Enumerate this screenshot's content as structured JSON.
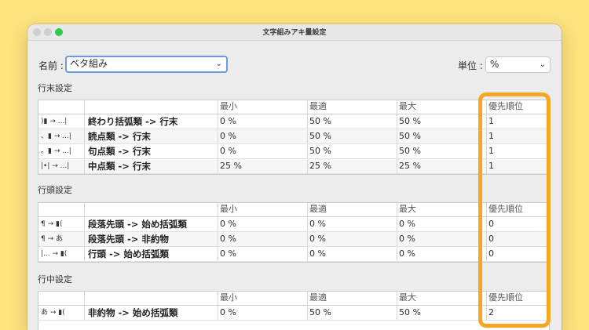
{
  "window": {
    "title": "文字組みアキ量設定"
  },
  "name_field": {
    "label": "名前 :",
    "value": "ベタ組み"
  },
  "unit_field": {
    "label": "単位 :",
    "value": "%"
  },
  "colors": {
    "background": "#fde37e",
    "highlight": "#f5a623",
    "focus": "#6b9ae3",
    "zoom": "#30c94a"
  },
  "headers": {
    "min": "最小",
    "opt": "最適",
    "max": "最大",
    "priority": "優先順位"
  },
  "sections": [
    {
      "title": "行末設定",
      "rows": [
        {
          "icon": ")▮ → ...|",
          "name": "終わり括弧類 -> 行末",
          "min": "0 %",
          "opt": "50 %",
          "max": "50 %",
          "priority": "1"
        },
        {
          "icon": "、▮ → ...|",
          "name": "読点類 -> 行末",
          "min": "0 %",
          "opt": "50 %",
          "max": "50 %",
          "priority": "1"
        },
        {
          "icon": "。▮ → ...|",
          "name": "句点類 -> 行末",
          "min": "0 %",
          "opt": "50 %",
          "max": "50 %",
          "priority": "1"
        },
        {
          "icon": "|•| → ...|",
          "name": "中点類 -> 行末",
          "min": "25 %",
          "opt": "25 %",
          "max": "25 %",
          "priority": "1"
        }
      ]
    },
    {
      "title": "行頭設定",
      "rows": [
        {
          "icon": "¶ → ▮(",
          "name": "段落先頭 -> 始め括弧類",
          "min": "0 %",
          "opt": "0 %",
          "max": "0 %",
          "priority": "0"
        },
        {
          "icon": "¶ → あ",
          "name": "段落先頭 -> 非約物",
          "min": "0 %",
          "opt": "0 %",
          "max": "0 %",
          "priority": "0"
        },
        {
          "icon": "|... → ▮(",
          "name": "行頭 -> 始め括弧類",
          "min": "0 %",
          "opt": "0 %",
          "max": "0 %",
          "priority": "0"
        }
      ]
    },
    {
      "title": "行中設定",
      "rows": [
        {
          "icon": "あ → ▮(",
          "name": "非約物 -> 始め括弧類",
          "min": "0 %",
          "opt": "50 %",
          "max": "50 %",
          "priority": "2"
        }
      ]
    }
  ]
}
